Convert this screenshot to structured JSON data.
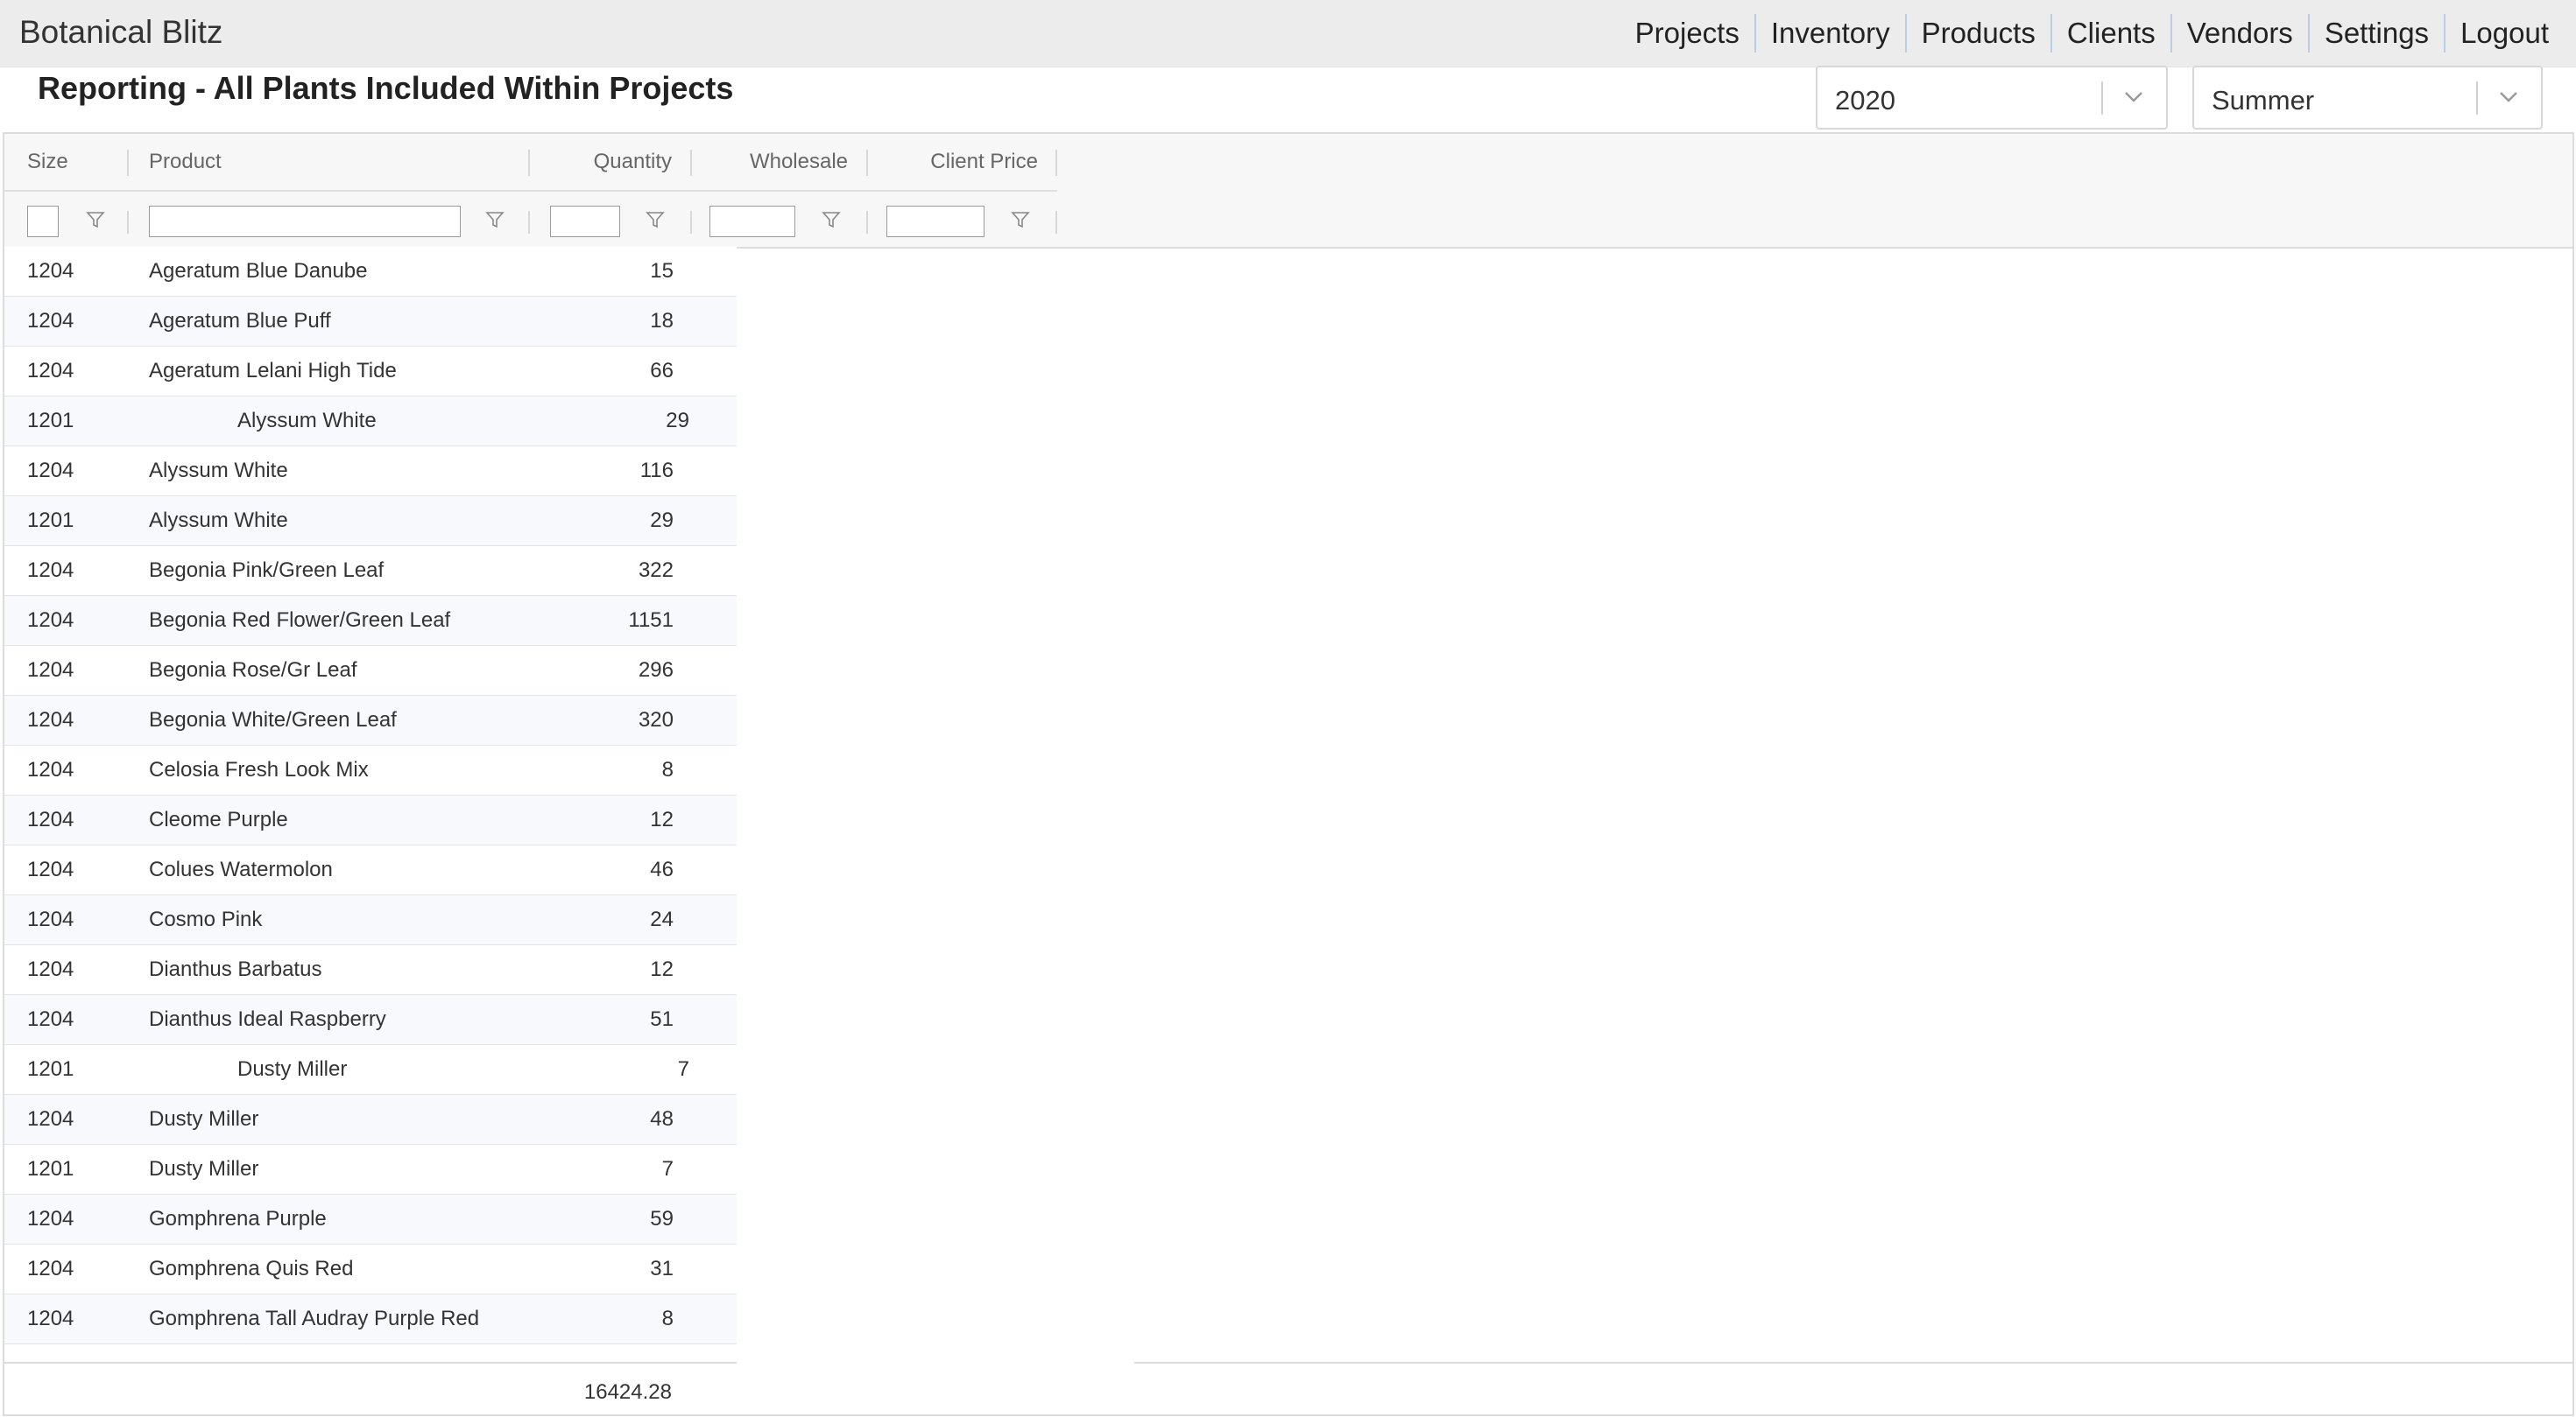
{
  "app": {
    "brand": "Botanical Blitz",
    "nav": [
      "Projects",
      "Inventory",
      "Products",
      "Clients",
      "Vendors",
      "Settings",
      "Logout"
    ]
  },
  "page": {
    "title": "Reporting - All Plants Included Within Projects",
    "year_selected": "2020",
    "season_selected": "Summer"
  },
  "grid": {
    "columns": [
      "Size",
      "Product",
      "Quantity",
      "Wholesale",
      "Client Price"
    ],
    "rows": [
      {
        "size": "1204",
        "product": "Ageratum Blue Danube",
        "quantity": "15"
      },
      {
        "size": "1204",
        "product": "Ageratum Blue Puff",
        "quantity": "18"
      },
      {
        "size": "1204",
        "product": "Ageratum Lelani High Tide",
        "quantity": "66"
      },
      {
        "size": "1201",
        "product": "Alyssum White",
        "quantity": "29",
        "child": true
      },
      {
        "size": "1204",
        "product": "Alyssum White",
        "quantity": "116"
      },
      {
        "size": "1201",
        "product": "Alyssum White",
        "quantity": "29"
      },
      {
        "size": "1204",
        "product": "Begonia Pink/Green Leaf",
        "quantity": "322"
      },
      {
        "size": "1204",
        "product": "Begonia Red Flower/Green Leaf",
        "quantity": "1151"
      },
      {
        "size": "1204",
        "product": "Begonia Rose/Gr Leaf",
        "quantity": "296"
      },
      {
        "size": "1204",
        "product": "Begonia White/Green Leaf",
        "quantity": "320"
      },
      {
        "size": "1204",
        "product": "Celosia Fresh Look Mix",
        "quantity": "8"
      },
      {
        "size": "1204",
        "product": "Cleome Purple",
        "quantity": "12"
      },
      {
        "size": "1204",
        "product": "Colues Watermolon",
        "quantity": "46"
      },
      {
        "size": "1204",
        "product": "Cosmo Pink",
        "quantity": "24"
      },
      {
        "size": "1204",
        "product": "Dianthus Barbatus",
        "quantity": "12"
      },
      {
        "size": "1204",
        "product": "Dianthus Ideal Raspberry",
        "quantity": "51"
      },
      {
        "size": "1201",
        "product": "Dusty Miller",
        "quantity": "7",
        "child": true
      },
      {
        "size": "1204",
        "product": "Dusty Miller",
        "quantity": "48"
      },
      {
        "size": "1201",
        "product": "Dusty Miller",
        "quantity": "7"
      },
      {
        "size": "1204",
        "product": "Gomphrena Purple",
        "quantity": "59"
      },
      {
        "size": "1204",
        "product": "Gomphrena Quis Red",
        "quantity": "31"
      },
      {
        "size": "1204",
        "product": "Gomphrena Tall Audray Purple Red",
        "quantity": "8"
      }
    ],
    "total": "16424.28"
  }
}
